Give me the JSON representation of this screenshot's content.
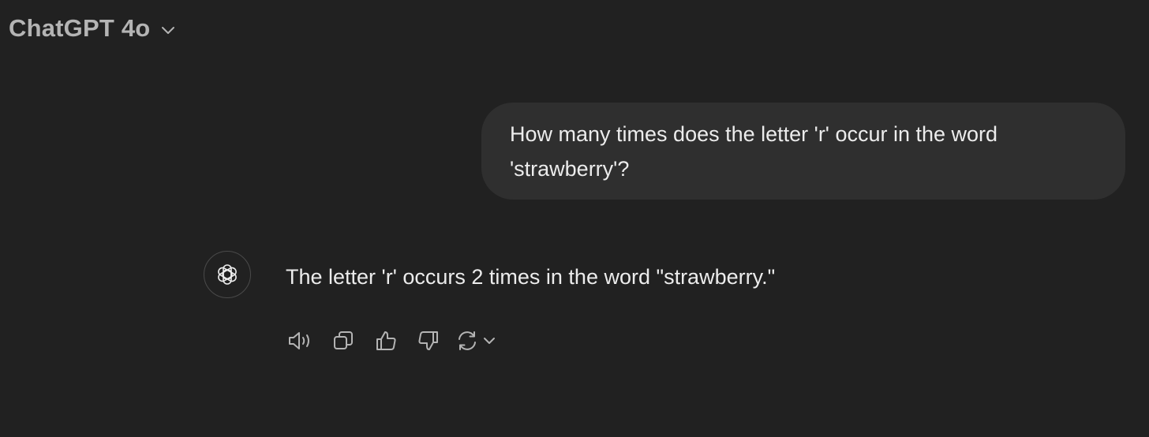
{
  "header": {
    "model_name": "ChatGPT 4o",
    "dropdown_icon": "chevron-down-icon"
  },
  "conversation": {
    "user_message": "How many times does the letter 'r' occur in the word 'strawberry'?",
    "assistant_message": "The letter 'r' occurs 2 times in the word \"strawberry.\"",
    "assistant_avatar_icon": "openai-logo-icon"
  },
  "message_actions": [
    {
      "name": "read-aloud",
      "icon": "speaker-icon"
    },
    {
      "name": "copy",
      "icon": "copy-icon"
    },
    {
      "name": "good-response",
      "icon": "thumbs-up-icon"
    },
    {
      "name": "bad-response",
      "icon": "thumbs-down-icon"
    },
    {
      "name": "regenerate",
      "icon": "refresh-icon"
    }
  ],
  "colors": {
    "background": "#212121",
    "user_bubble": "#2f2f2f",
    "text": "#ececec",
    "muted": "#b4b4b4"
  }
}
